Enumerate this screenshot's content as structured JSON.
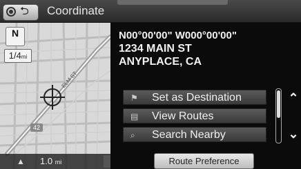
{
  "header": {
    "title": "Coordinate",
    "back_glyph": "⮌"
  },
  "map": {
    "compass_label": "N",
    "scale_value": "1/4",
    "scale_unit": "mi",
    "footer_distance": "1.0",
    "footer_unit": "mi",
    "street_label": "ELM ST",
    "road_number": "42"
  },
  "location": {
    "coordinates": "N00°00'00\" W000°00'00\"",
    "street": "1234 MAIN ST",
    "city": "ANYPLACE, CA"
  },
  "options": [
    {
      "label": "Set as Destination",
      "icon": "flag-icon"
    },
    {
      "label": "View Routes",
      "icon": "routes-icon"
    },
    {
      "label": "Search Nearby",
      "icon": "search-icon"
    }
  ],
  "footer": {
    "route_preference": "Route Preference"
  }
}
